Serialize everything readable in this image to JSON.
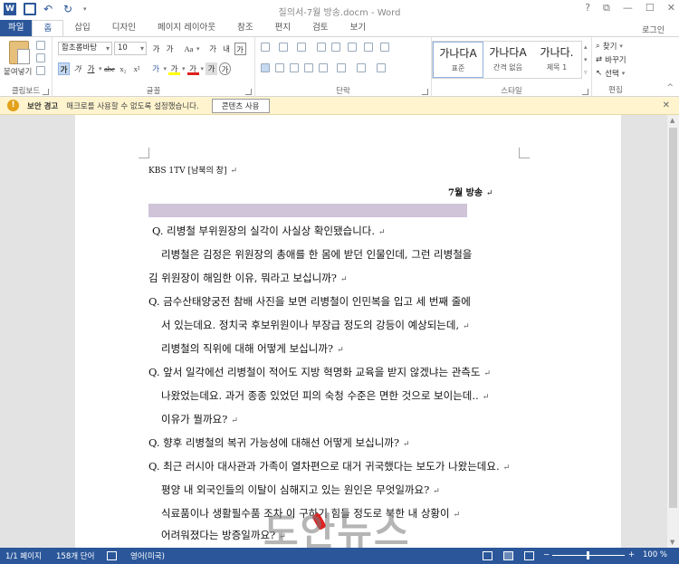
{
  "window": {
    "title": "질의서-7월 방송.docm - Word",
    "controls": [
      "?",
      "⧉",
      "—",
      "☐",
      "✕"
    ]
  },
  "ribbon_tabs": [
    "파일",
    "홈",
    "삽입",
    "디자인",
    "페이지 레이아웃",
    "참조",
    "편지",
    "검토",
    "보기"
  ],
  "account": "로그인",
  "clipboard": {
    "paste": "붙여넣기",
    "label": "클립보드"
  },
  "font": {
    "name": "함초롬바탕",
    "size": "10",
    "label": "글꼴",
    "grow": "가",
    "shrink": "가",
    "case": "Aa",
    "clear": "가",
    "phonetic": "내",
    "border": "가",
    "bold": "가",
    "italic": "가",
    "underline": "가",
    "strike": "abe",
    "sub": "x₂",
    "sup": "x²",
    "effects": "가",
    "highlight": "가",
    "color": "가",
    "shade": "가",
    "circle": "가"
  },
  "paragraph": {
    "label": "단락"
  },
  "styles": {
    "label": "스타일",
    "items": [
      {
        "sample": "가나다A",
        "name": "표준"
      },
      {
        "sample": "가나다A",
        "name": "간격 없음"
      },
      {
        "sample": "가나다.",
        "name": "제목 1"
      }
    ]
  },
  "editing": {
    "find": "찾기",
    "replace": "바꾸기",
    "select": "선택",
    "label": "편집"
  },
  "security_bar": {
    "title": "보안 경고",
    "message": "매크로를 사용할 수 없도록 설정했습니다.",
    "button": "콘텐츠 사용"
  },
  "document": {
    "header": "KBS 1TV [남북의 창]",
    "date": "7월   방송",
    "lines": [
      {
        "text": "Q. 리병철 부위원장의 실각이 사실상 확인됐습니다."
      },
      {
        "text": "리병철은 김정은 위원장의 총애를 한 몸에 받던 인물인데, 그런 리병철을"
      },
      {
        "text": "김 위원장이 해임한 이유, 뭐라고 보십니까?"
      },
      {
        "text": "Q. 금수산태양궁전 참배 사진을 보면 리병철이 인민복을 입고 세 번째 줄에"
      },
      {
        "text": "서 있는데요. 정치국 후보위원이나 부장급 정도의 강등이 예상되는데,"
      },
      {
        "text": "리병철의 직위에 대해 어떻게 보십니까?"
      },
      {
        "text": "Q. 앞서 일각에선 리병철이 적어도 지방 혁명화 교육을 받지 않겠냐는 관측도"
      },
      {
        "text": "나왔었는데요. 과거 종종 있었던 피의 숙청 수준은 면한 것으로 보이는데.."
      },
      {
        "text": "이유가 뭘까요?"
      },
      {
        "text": "Q. 향후 리병철의 복귀 가능성에 대해선 어떻게 보십니까?"
      },
      {
        "text": "Q. 최근 러시아 대사관과 가족이 열차편으로 대거 귀국했다는 보도가 나왔는데요."
      },
      {
        "text": "평양 내 외국인들의 이탈이 심해지고 있는 원인은 무엇일까요?"
      },
      {
        "text": "식료품이나 생활필수품 조차 이 구하기 힘들 정도로 북한 내 상황이"
      },
      {
        "text": "어려워졌다는 방증일까요?"
      }
    ]
  },
  "watermark": "도안뉴스",
  "status_bar": {
    "page": "1/1 페이지",
    "words": "158개 단어",
    "language": "영어(미국)",
    "zoom": "100 %",
    "zoom_minus": "−",
    "zoom_plus": "+"
  },
  "colors": {
    "accent": "#2b579a",
    "security_bar": "#fff4ce",
    "spell_underline": "#e02020"
  }
}
